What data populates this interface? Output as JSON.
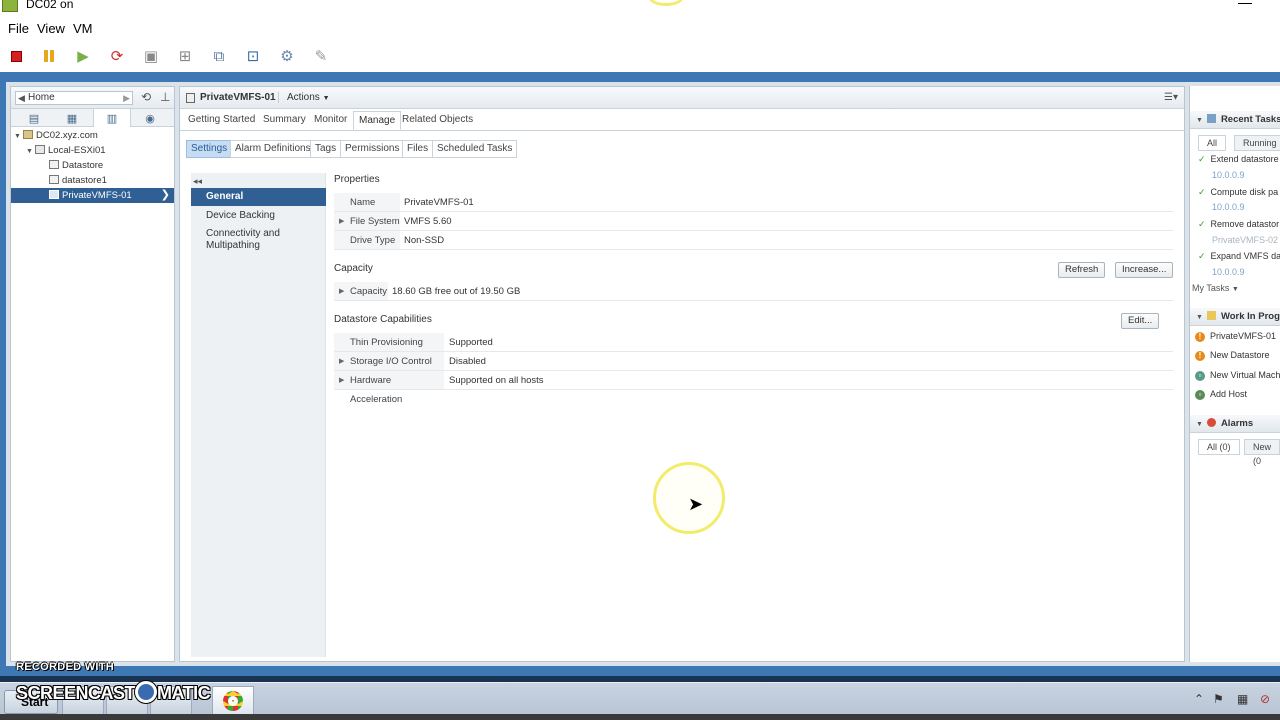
{
  "window": {
    "title": "DC02 on"
  },
  "menu": [
    "File",
    "View",
    "VM"
  ],
  "toolbar_icons": [
    "stop-icon",
    "pause-icon",
    "play-icon",
    "reset-icon",
    "snapshot-icon",
    "revert-snapshot-icon",
    "manage-snapshots-icon",
    "console-icon",
    "settings-icon",
    "edit-icon"
  ],
  "nav": {
    "home": "Home",
    "tree": [
      {
        "label": "DC02.xyz.com",
        "type": "dc"
      },
      {
        "label": "Local-ESXi01",
        "type": "host"
      },
      {
        "label": "Datastore",
        "type": "ds"
      },
      {
        "label": "datastore1",
        "type": "ds"
      },
      {
        "label": "PrivateVMFS-01",
        "type": "ds",
        "selected": true
      }
    ]
  },
  "object": {
    "title": "PrivateVMFS-01",
    "actions": "Actions"
  },
  "top_tabs": [
    "Getting Started",
    "Summary",
    "Monitor",
    "Manage",
    "Related Objects"
  ],
  "sub_tabs": [
    "Settings",
    "Alarm Definitions",
    "Tags",
    "Permissions",
    "Files",
    "Scheduled Tasks"
  ],
  "settings_nav": {
    "collapse": "◂◂",
    "items": [
      "General",
      "Device Backing",
      "Connectivity and Multipathing"
    ]
  },
  "properties": {
    "title": "Properties",
    "rows": [
      {
        "label": "Name",
        "value": "PrivateVMFS-01",
        "expandable": false
      },
      {
        "label": "File System",
        "value": "VMFS 5.60",
        "expandable": true
      },
      {
        "label": "Drive Type",
        "value": "Non-SSD",
        "expandable": false
      }
    ]
  },
  "capacity": {
    "title": "Capacity",
    "refresh": "Refresh",
    "increase": "Increase...",
    "row": {
      "label": "Capacity",
      "value": "18.60 GB free out of 19.50 GB"
    }
  },
  "capabilities": {
    "title": "Datastore Capabilities",
    "edit": "Edit...",
    "rows": [
      {
        "label": "Thin Provisioning",
        "value": "Supported",
        "expandable": false
      },
      {
        "label": "Storage I/O Control",
        "value": "Disabled",
        "expandable": true
      },
      {
        "label": "Hardware Acceleration",
        "value": "Supported on all hosts",
        "expandable": true
      }
    ]
  },
  "right_panel": {
    "recent_tasks": {
      "title": "Recent Tasks",
      "tabs": [
        "All",
        "Running"
      ],
      "items": [
        {
          "task": "Extend datastore",
          "target": "10.0.0.9"
        },
        {
          "task": "Compute disk pa",
          "target": "10.0.0.9"
        },
        {
          "task": "Remove datastor",
          "target": "PrivateVMFS-02"
        },
        {
          "task": "Expand VMFS da",
          "target": "10.0.0.9"
        }
      ],
      "my_tasks": "My Tasks"
    },
    "work_in_progress": {
      "title": "Work In Prog",
      "items": [
        "PrivateVMFS-01",
        "New Datastore",
        "New Virtual Mach",
        "Add Host"
      ]
    },
    "alarms": {
      "title": "Alarms",
      "tabs": [
        "All (0)",
        "New (0"
      ]
    }
  },
  "watermark": {
    "line1": "RECORDED WITH",
    "line2a": "SCREENCAST",
    "line2b": "MATIC"
  },
  "taskbar": {
    "start": "Start"
  },
  "colors": {
    "frame": "#3d78b5",
    "selection": "#2f5f93",
    "subtab_active": "#c5dcf3"
  }
}
